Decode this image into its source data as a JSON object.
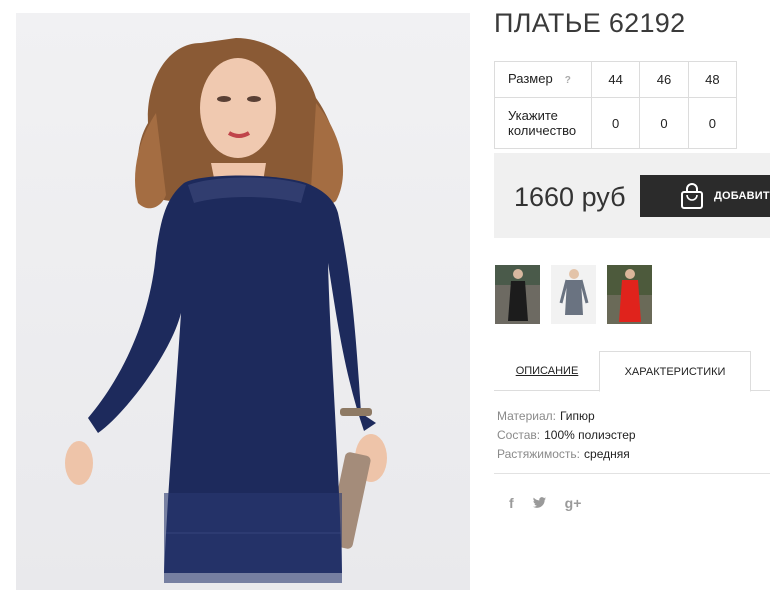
{
  "product": {
    "title": "ПЛАТЬЕ 62192",
    "image_alt_icon": "dress-photo"
  },
  "sizes": {
    "size_label": "Размер",
    "help_label": "?",
    "qty_label_line1": "Укажите",
    "qty_label_line2": "количество",
    "values": [
      "44",
      "46",
      "48"
    ],
    "quantities": [
      "0",
      "0",
      "0"
    ]
  },
  "purchase": {
    "price": "1660 руб",
    "add_button_label": "ДОБАВИТЬ",
    "button_icon": "shopping-bag-icon"
  },
  "thumbnails": [
    {
      "name": "thumbnail-black-dress",
      "color": "#1c1c1c"
    },
    {
      "name": "thumbnail-grey-dress",
      "color": "#6a7381"
    },
    {
      "name": "thumbnail-red-dress",
      "color": "#e0231c"
    }
  ],
  "tabs": {
    "description": "ОПИСАНИЕ",
    "characteristics": "ХАРАКТЕРИСТИКИ"
  },
  "specs": [
    {
      "key": "Материал:",
      "value": "Гипюр"
    },
    {
      "key": "Состав:",
      "value": "100% полиэстер"
    },
    {
      "key": "Растяжимость:",
      "value": "средняя"
    }
  ],
  "social": {
    "facebook": "f",
    "twitter": "twitter-icon",
    "googleplus": "g+"
  },
  "colors": {
    "dress": "#1d2a5c",
    "button": "#2b2b2b",
    "price_bg": "#f0f0f0"
  }
}
